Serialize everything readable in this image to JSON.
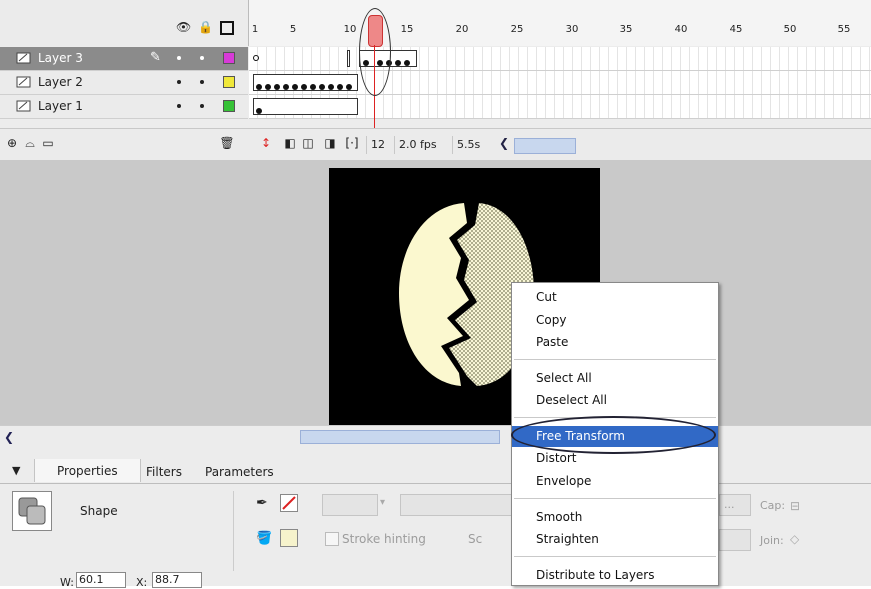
{
  "timeline": {
    "frame_numbers": [
      "1",
      "5",
      "10",
      "15",
      "20",
      "25",
      "30",
      "35",
      "40",
      "45",
      "50",
      "55"
    ],
    "layers": [
      {
        "name": "Layer 3",
        "color": "#d83ad8",
        "selected": true
      },
      {
        "name": "Layer 2",
        "color": "#f0e83a",
        "selected": false
      },
      {
        "name": "Layer 1",
        "color": "#36c236",
        "selected": false
      }
    ],
    "status": {
      "current_frame": "12",
      "frame_rate": "2.0 fps",
      "elapsed": "5.5s"
    }
  },
  "properties": {
    "tabs": [
      "Properties",
      "Filters",
      "Parameters"
    ],
    "selection_type": "Shape",
    "stroke_hinting_label": "Stroke hinting",
    "sc_label": "Sc",
    "cap_label": "Cap:",
    "join_label": "Join:",
    "width_label": "W:",
    "width_value": "60.1",
    "x_label": "X:",
    "x_value": "88.7"
  },
  "context_menu": {
    "items": [
      {
        "label": "Cut"
      },
      {
        "label": "Copy"
      },
      {
        "label": "Paste"
      },
      {
        "label": "Select All"
      },
      {
        "label": "Deselect All"
      },
      {
        "label": "Free Transform",
        "highlighted": true
      },
      {
        "label": "Distort"
      },
      {
        "label": "Envelope"
      },
      {
        "label": "Smooth"
      },
      {
        "label": "Straighten"
      },
      {
        "label": "Distribute to Layers"
      }
    ]
  },
  "colors": {
    "stage_bg": "#000000",
    "egg_fill": "#fbf8cf",
    "menu_highlight": "#3169c6",
    "selected_layer": "#8b8b8b"
  },
  "icons": [
    "eye-icon",
    "lock-icon",
    "outline-icon",
    "pencil-icon",
    "trash-icon",
    "onion-skin-icon",
    "edit-multiple-frames-icon",
    "center-frame-icon",
    "scroll-left-icon",
    "pen-icon",
    "paint-bucket-icon"
  ]
}
